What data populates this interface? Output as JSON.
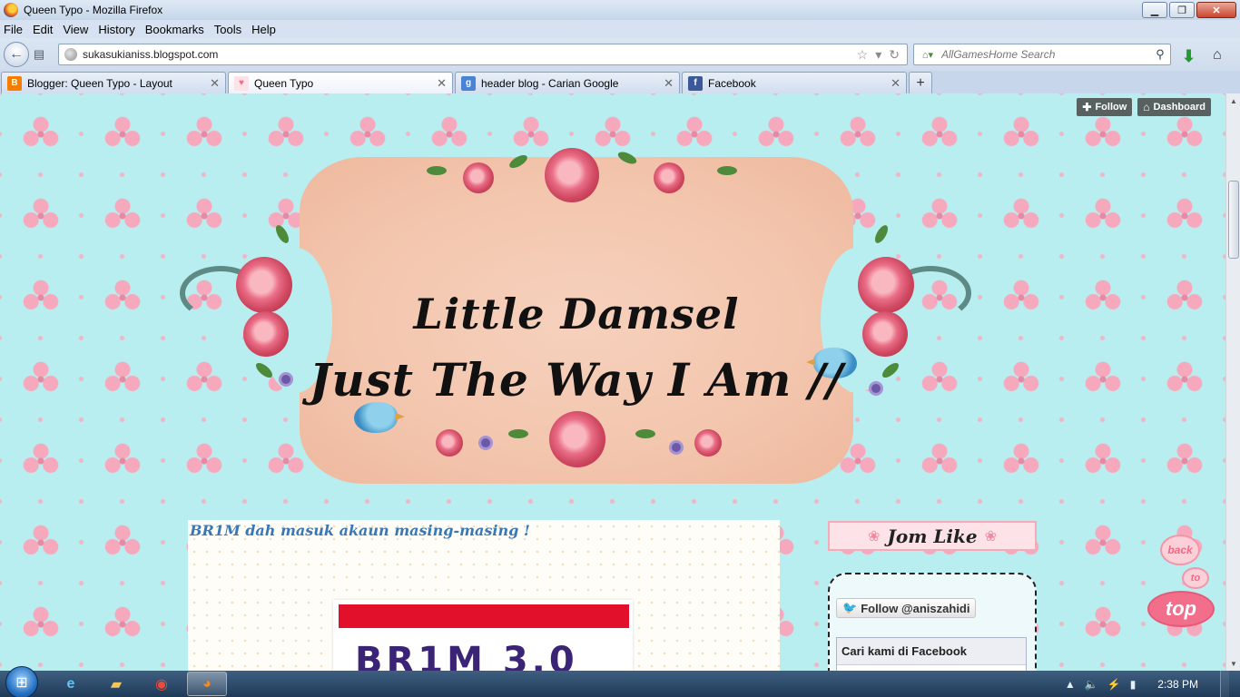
{
  "window": {
    "title": "Queen Typo - Mozilla Firefox"
  },
  "menubar": {
    "items": [
      "File",
      "Edit",
      "View",
      "History",
      "Bookmarks",
      "Tools",
      "Help"
    ]
  },
  "navbar": {
    "url": "sukasukianiss.blogspot.com",
    "search_placeholder": "AllGamesHome Search"
  },
  "tabs": [
    {
      "label": "Blogger: Queen Typo - Layout",
      "favicon": "blogger-icon",
      "color": "#f57d00",
      "active": false
    },
    {
      "label": "Queen Typo",
      "favicon": "heart-icon",
      "color": "#f36e8b",
      "active": true
    },
    {
      "label": "header blog - Carian Google",
      "favicon": "google-icon",
      "color": "#4a82d6",
      "active": false
    },
    {
      "label": "Facebook",
      "favicon": "facebook-icon",
      "color": "#3b5998",
      "active": false
    }
  ],
  "blogger_bar": {
    "follow_label": "Follow",
    "dashboard_label": "Dashboard"
  },
  "header": {
    "line1": "Little Damsel",
    "line2": "Just The Way I Am //"
  },
  "post": {
    "title": "BR1M dah masuk akaun masing-masing !",
    "image_text": "BR1M 3.0"
  },
  "sidebar": {
    "jom_like": "Jom Like",
    "twitter_follow": "Follow @aniszahidi",
    "facebook_title": "Cari kami di Facebook"
  },
  "back_to_top": {
    "word1": "back",
    "word2": "to",
    "word3": "top"
  },
  "taskbar": {
    "time": "2:38 PM"
  },
  "colors": {
    "accent_blue": "#3a78b5",
    "pink": "#f36e8b",
    "background": "#b8eef0"
  }
}
